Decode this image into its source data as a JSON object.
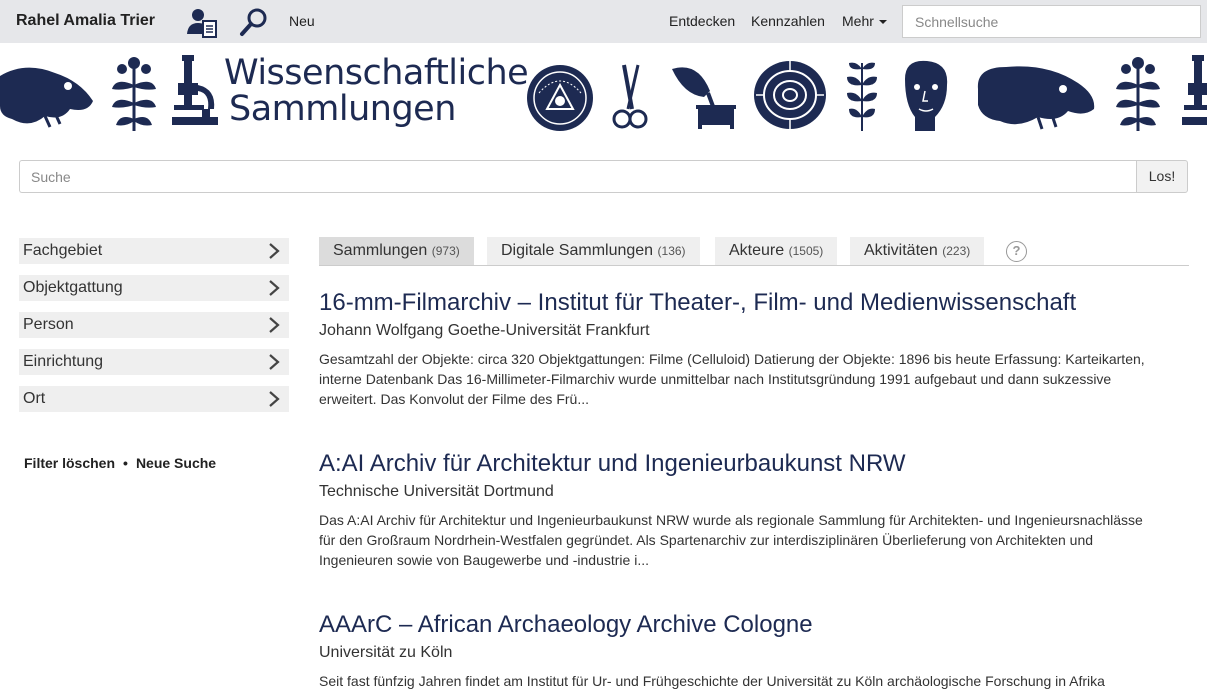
{
  "navbar": {
    "brand": "Rahel Amalia Trier",
    "user_icon": "user-document-icon",
    "search_icon": "magnifier-icon",
    "neu": "Neu",
    "entdecken": "Entdecken",
    "kennzahlen": "Kennzahlen",
    "mehr": "Mehr",
    "quick_search_placeholder": "Schnellsuche"
  },
  "banner": {
    "title_line1": "Wissenschaftliche",
    "title_line2": "Sammlungen",
    "icon_color": "#1d2a52"
  },
  "search": {
    "placeholder": "Suche",
    "button": "Los!"
  },
  "facets": [
    {
      "label": "Fachgebiet"
    },
    {
      "label": "Objektgattung"
    },
    {
      "label": "Person"
    },
    {
      "label": "Einrichtung"
    },
    {
      "label": "Ort"
    }
  ],
  "side_links": {
    "clear": "Filter löschen",
    "separator": "•",
    "new_search": "Neue Suche"
  },
  "tabs": [
    {
      "label": "Sammlungen",
      "count": "(973)",
      "active": true
    },
    {
      "label": "Digitale Sammlungen",
      "count": "(136)",
      "active": false
    },
    {
      "label": "Akteure",
      "count": "(1505)",
      "active": false
    },
    {
      "label": "Aktivitäten",
      "count": "(223)",
      "active": false
    }
  ],
  "help": "?",
  "results": [
    {
      "title": "16-mm-Filmarchiv – Institut für Theater-, Film- und Medienwissenschaft",
      "institution": "Johann Wolfgang Goethe-Universität Frankfurt",
      "description": "Gesamtzahl der Objekte: circa 320 Objektgattungen: Filme (Celluloid) Datierung der Objekte: 1896 bis heute Erfassung: Karteikarten, interne Datenbank Das 16-Millimeter-Filmarchiv wurde unmittelbar nach Institutsgründung 1991 aufgebaut und dann sukzessive erweitert. Das Konvolut der Filme des Frü..."
    },
    {
      "title": "A:AI Archiv für Architektur und Ingenieurbaukunst NRW",
      "institution": "Technische Universität Dortmund",
      "description": "Das A:AI Archiv für Architektur und Ingenieurbaukunst NRW wurde als regionale Sammlung für Architekten- und Ingenieursnachlässe für den Großraum Nordrhein-Westfalen gegründet. Als Spartenarchiv zur interdisziplinären Überlieferung von Architekten und Ingenieuren sowie von Baugewerbe und -industrie i..."
    },
    {
      "title": "AAArC – African Archaeology Archive Cologne",
      "institution": "Universität zu Köln",
      "description": "Seit fast fünfzig Jahren findet am Institut für Ur- und Frühgeschichte der Universität zu Köln archäologische Forschung in Afrika"
    }
  ]
}
